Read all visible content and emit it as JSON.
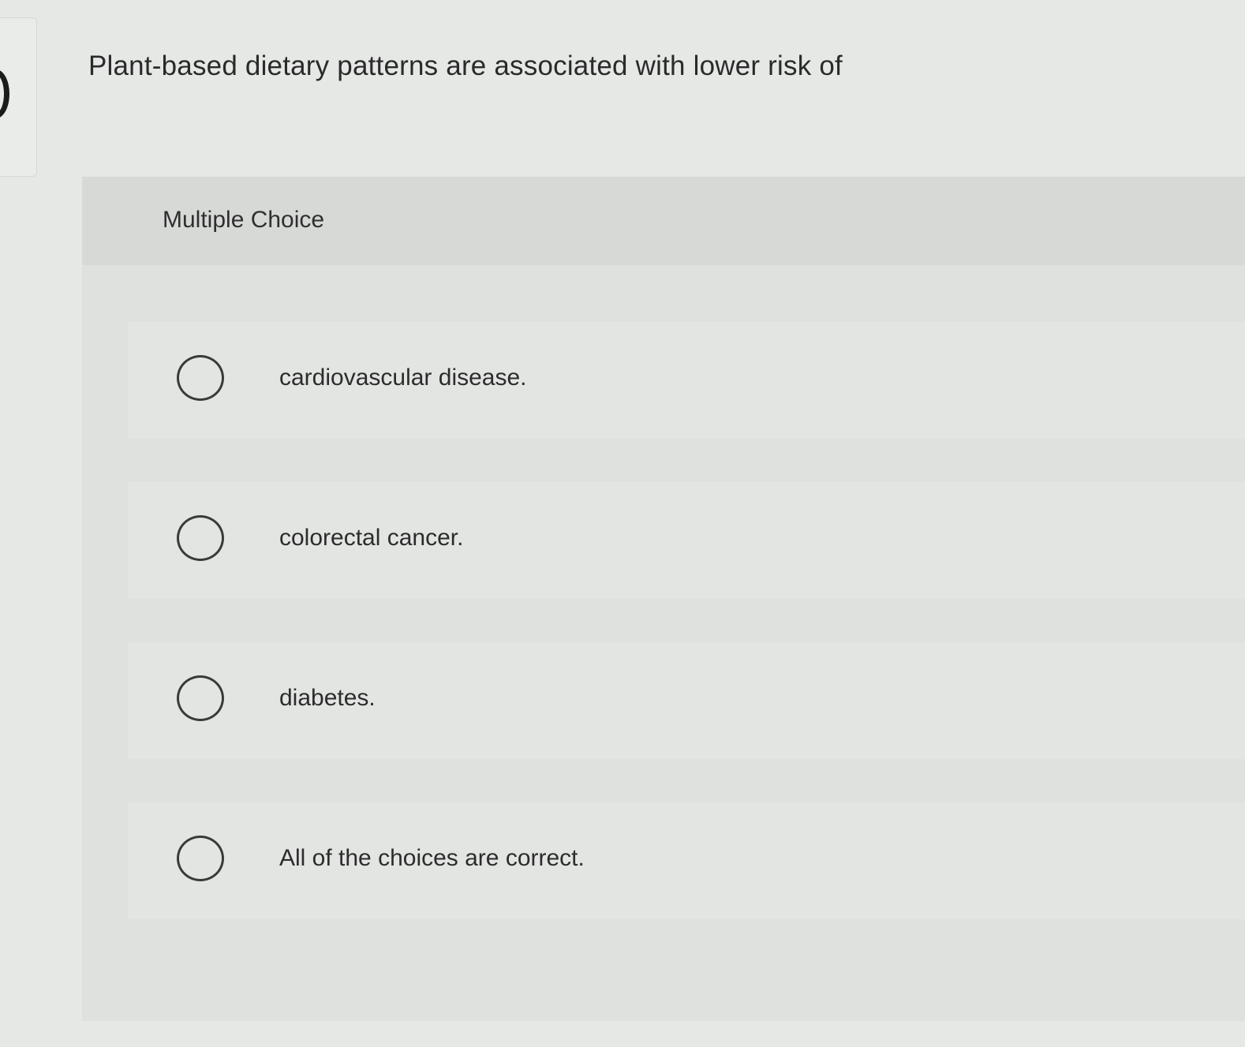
{
  "question": {
    "text": "Plant-based dietary patterns are associated with lower risk of"
  },
  "panel": {
    "label": "Multiple Choice"
  },
  "choices": [
    {
      "text": "cardiovascular disease."
    },
    {
      "text": "colorectal cancer."
    },
    {
      "text": "diabetes."
    },
    {
      "text": "All of the choices are correct."
    }
  ]
}
